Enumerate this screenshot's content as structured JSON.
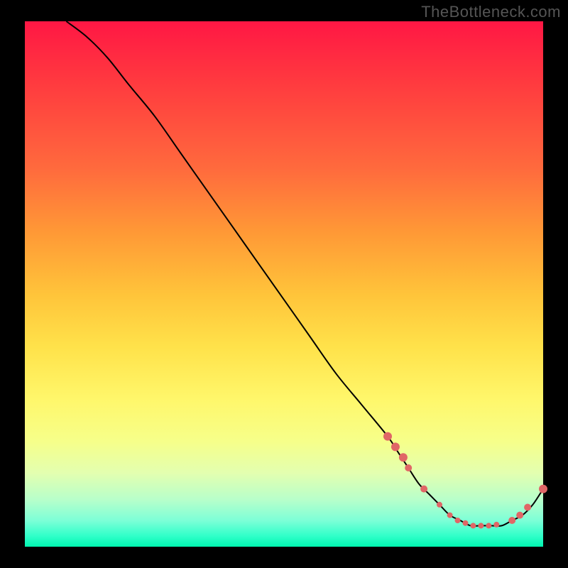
{
  "watermark": "TheBottleneck.com",
  "chart_data": {
    "type": "line",
    "title": "",
    "xlabel": "",
    "ylabel": "",
    "xlim": [
      0,
      100
    ],
    "ylim": [
      0,
      100
    ],
    "series": [
      {
        "name": "curve",
        "x": [
          8,
          12,
          16,
          20,
          25,
          30,
          35,
          40,
          45,
          50,
          55,
          60,
          65,
          70,
          72,
          74,
          76,
          78,
          80,
          82,
          84,
          86,
          88,
          90,
          92,
          94,
          96,
          98,
          100
        ],
        "y": [
          100,
          97,
          93,
          88,
          82,
          75,
          68,
          61,
          54,
          47,
          40,
          33,
          27,
          21,
          18,
          15,
          12,
          10,
          8,
          6,
          5,
          4,
          4,
          4,
          4,
          5,
          6,
          8,
          11
        ],
        "stroke": "#000000",
        "stroke_width": 2
      }
    ],
    "markers": [
      {
        "x": 70.0,
        "y": 21.0,
        "r": 6,
        "fill": "#e06666"
      },
      {
        "x": 71.5,
        "y": 19.0,
        "r": 6,
        "fill": "#e06666"
      },
      {
        "x": 73.0,
        "y": 17.0,
        "r": 6,
        "fill": "#e06666"
      },
      {
        "x": 74.0,
        "y": 15.0,
        "r": 5,
        "fill": "#e06666"
      },
      {
        "x": 77.0,
        "y": 11.0,
        "r": 5,
        "fill": "#e06666"
      },
      {
        "x": 80.0,
        "y": 8.0,
        "r": 4,
        "fill": "#e06666"
      },
      {
        "x": 82.0,
        "y": 6.0,
        "r": 4,
        "fill": "#e06666"
      },
      {
        "x": 83.5,
        "y": 5.0,
        "r": 4,
        "fill": "#e06666"
      },
      {
        "x": 85.0,
        "y": 4.5,
        "r": 4,
        "fill": "#e06666"
      },
      {
        "x": 86.5,
        "y": 4.0,
        "r": 4,
        "fill": "#e06666"
      },
      {
        "x": 88.0,
        "y": 4.0,
        "r": 4,
        "fill": "#e06666"
      },
      {
        "x": 89.5,
        "y": 4.0,
        "r": 4,
        "fill": "#e06666"
      },
      {
        "x": 91.0,
        "y": 4.2,
        "r": 4,
        "fill": "#e06666"
      },
      {
        "x": 94.0,
        "y": 5.0,
        "r": 5,
        "fill": "#e06666"
      },
      {
        "x": 95.5,
        "y": 6.0,
        "r": 5,
        "fill": "#e06666"
      },
      {
        "x": 97.0,
        "y": 7.5,
        "r": 5,
        "fill": "#e06666"
      },
      {
        "x": 100.0,
        "y": 11.0,
        "r": 6,
        "fill": "#e06666"
      }
    ],
    "legend": false,
    "grid": false
  },
  "colors": {
    "curve": "#000000",
    "marker": "#e06666",
    "background_top": "#ff1744",
    "background_bottom": "#00f5b0",
    "frame": "#000000"
  }
}
